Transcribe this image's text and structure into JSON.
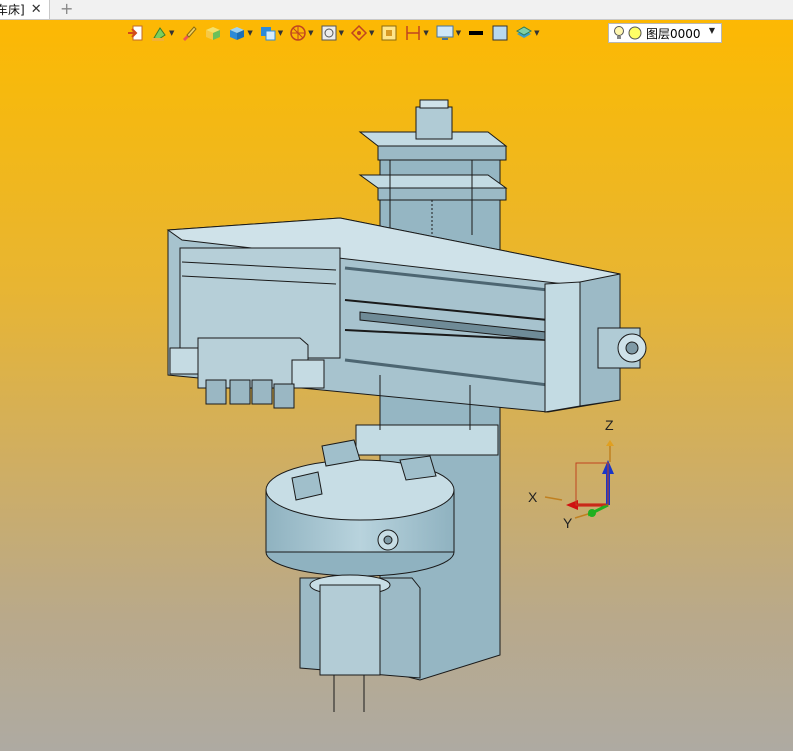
{
  "tab": {
    "label": "车床]",
    "close_glyph": "✕",
    "add_glyph": "+"
  },
  "toolbar": {
    "icons": [
      "insert-icon",
      "paint-bucket-icon",
      "brush-icon",
      "shade-box-icon",
      "solid-box-icon",
      "view-cube-icon",
      "render-mode-icon",
      "display-filter-icon",
      "snap-target-icon",
      "frame-icon",
      "dimension-icon",
      "monitor-view-icon",
      "line-color-icon",
      "fill-color-icon",
      "layer-stack-icon"
    ],
    "layer": {
      "name": "图层0000",
      "bulb": "lightbulb-icon",
      "color_dot": "#ffff66"
    }
  },
  "viewport": {
    "background_top": "#ffb800",
    "background_bottom": "#aeaaa2",
    "model_color": "#a9c6d1",
    "axes": {
      "x": "X",
      "y": "Y",
      "z": "Z"
    }
  }
}
